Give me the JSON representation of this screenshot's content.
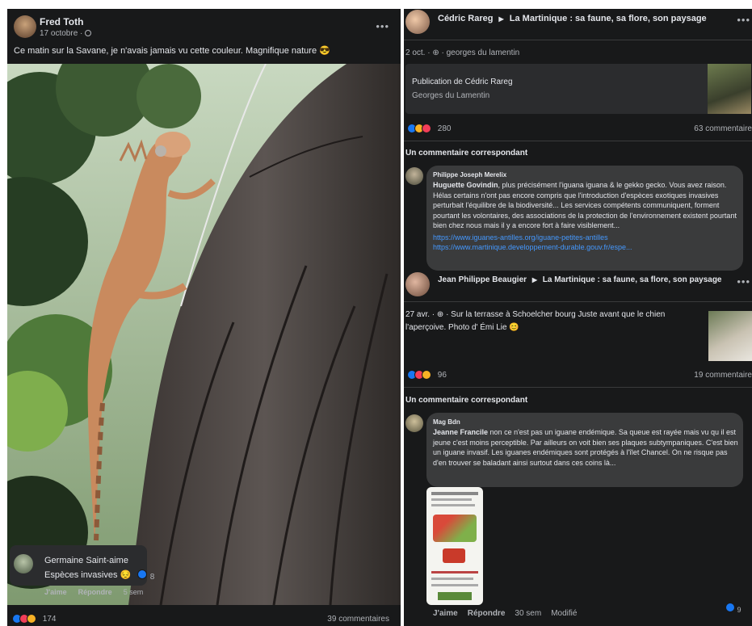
{
  "left_post": {
    "author": "Fred Toth",
    "date": "17 octobre ·",
    "privacy_icon": "globe-icon",
    "text": "Ce matin sur la Savane, je n'avais jamais vu cette couleur. Magnifique nature 😎",
    "comment": {
      "author": "Germaine Saint-aime",
      "text": "Espèces invasives 😔",
      "reaction_count": "8",
      "actions": [
        "J'aime",
        "Répondre",
        "5 sem"
      ]
    },
    "reactions_count": "174",
    "comments_count": "39 commentaires"
  },
  "right_feed": {
    "result1": {
      "author": "Cédric Rareg",
      "arrow": "▶",
      "group": "La Martinique : sa faune, sa flore, son paysage",
      "meta": "2 oct. · ⊕ · georges du lamentin",
      "shared_title": "Publication de Cédric Rareg",
      "shared_subtitle": "Georges du Lamentin",
      "reactions_count": "280",
      "comments_count": "63 commentaire",
      "match_heading": "Un commentaire correspondant",
      "comment_author": "Philippe Joseph Merelix",
      "comment_mention": "Huguette Govindin",
      "comment_text": ", plus précisément l'iguana iguana & le gekko gecko. Vous avez raison. Hélas certains n'ont pas encore compris que l'introduction d'espèces exotiques invasives perturbait l'équilibre de la biodiversité... Les services compétents communiquent, forment pourtant les volontaires, des associations de la protection de l'environnement existent pourtant bien chez nous mais il y a encore fort à faire visiblement...",
      "link1": "https://www.iguanes-antilles.org/iguane-petites-antilles",
      "link2": "https://www.martinique.developpement-durable.gouv.fr/espe..."
    },
    "result2": {
      "author": "Jean Philippe Beaugier",
      "arrow": "▶",
      "group": "La Martinique : sa faune, sa flore, son paysage",
      "meta_line1": "27 avr. · ⊕ · Sur la terrasse à Schoelcher bourg Juste avant que le chien",
      "meta_line2": "l'aperçoive. Photo d' Émi Lie 😊",
      "reactions_count": "96",
      "comments_count": "19 commentaire",
      "match_heading": "Un commentaire correspondant",
      "comment_author": "Mag Bdn",
      "comment_mention": "Jeanne Francile",
      "comment_text": " non ce n'est pas un iguane endémique. Sa queue est rayée mais vu qu il est jeune c'est moins perceptible. Par ailleurs on voit bien ses plaques subtympaniques. C'est bien un iguane invasif. Les iguanes endémiques sont protégés à l'îlet Chancel. On ne risque pas d'en trouver se baladant ainsi surtout dans ces coins là...",
      "actions": [
        "J'aime",
        "Répondre",
        "30 sem",
        "Modifié"
      ],
      "reaction_count": "9"
    }
  },
  "colors": {
    "bg": "#18191a",
    "bubble": "#3a3b3c",
    "text": "#e4e6eb",
    "muted": "#b0b3b8",
    "link": "#4599ff",
    "like": "#1877f2",
    "love": "#f33e58",
    "wow": "#f7b125"
  }
}
